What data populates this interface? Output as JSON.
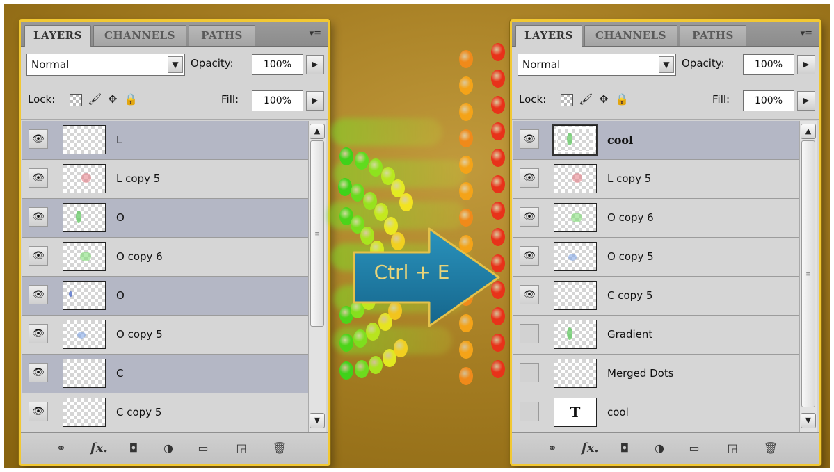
{
  "colors": {
    "panel_border": "#f2c832",
    "selected_row": "#b4b7c5",
    "arrow_fill": "#1e7ea6",
    "arrow_stroke": "#e4c14a"
  },
  "left_panel": {
    "tabs": [
      "LAYERS",
      "CHANNELS",
      "PATHS"
    ],
    "menu_icon": "panel-menu-icon",
    "blend_mode": "Normal",
    "opacity_label": "Opacity:",
    "opacity_value": "100%",
    "lock_label": "Lock:",
    "fill_label": "Fill:",
    "fill_value": "100%",
    "layers": [
      {
        "name": "L",
        "selected": true,
        "visible": true,
        "thumb": "blank"
      },
      {
        "name": "L copy 5",
        "selected": false,
        "visible": true,
        "thumb": "red"
      },
      {
        "name": "O",
        "selected": true,
        "visible": true,
        "thumb": "green-small"
      },
      {
        "name": "O copy 6",
        "selected": false,
        "visible": true,
        "thumb": "green"
      },
      {
        "name": "O",
        "selected": true,
        "visible": true,
        "thumb": "blue-small"
      },
      {
        "name": "O copy 5",
        "selected": false,
        "visible": true,
        "thumb": "blue"
      },
      {
        "name": "C",
        "selected": true,
        "visible": true,
        "thumb": "blank"
      },
      {
        "name": "C copy 5",
        "selected": false,
        "visible": true,
        "thumb": "blank"
      }
    ]
  },
  "center": {
    "shortcut_label": "Ctrl + E"
  },
  "right_panel": {
    "tabs": [
      "LAYERS",
      "CHANNELS",
      "PATHS"
    ],
    "menu_icon": "panel-menu-icon",
    "blend_mode": "Normal",
    "opacity_label": "Opacity:",
    "opacity_value": "100%",
    "lock_label": "Lock:",
    "fill_label": "Fill:",
    "fill_value": "100%",
    "layers": [
      {
        "name": "cool",
        "selected": true,
        "visible": true,
        "thumb": "green-small",
        "bold": true
      },
      {
        "name": "L copy 5",
        "selected": false,
        "visible": true,
        "thumb": "red"
      },
      {
        "name": "O copy 6",
        "selected": false,
        "visible": true,
        "thumb": "green"
      },
      {
        "name": "O copy 5",
        "selected": false,
        "visible": true,
        "thumb": "blue"
      },
      {
        "name": "C copy 5",
        "selected": false,
        "visible": true,
        "thumb": "blank"
      },
      {
        "name": "Gradient",
        "selected": false,
        "visible": false,
        "thumb": "green-small"
      },
      {
        "name": "Merged Dots",
        "selected": false,
        "visible": false,
        "thumb": "blank"
      },
      {
        "name": "cool",
        "selected": false,
        "visible": false,
        "thumb": "type",
        "type_glyph": "T"
      }
    ]
  },
  "bottom_icons": [
    "link-layers-icon",
    "fx-icon",
    "add-mask-icon",
    "adjustment-layer-icon",
    "new-group-icon",
    "new-layer-icon",
    "delete-layer-icon"
  ]
}
